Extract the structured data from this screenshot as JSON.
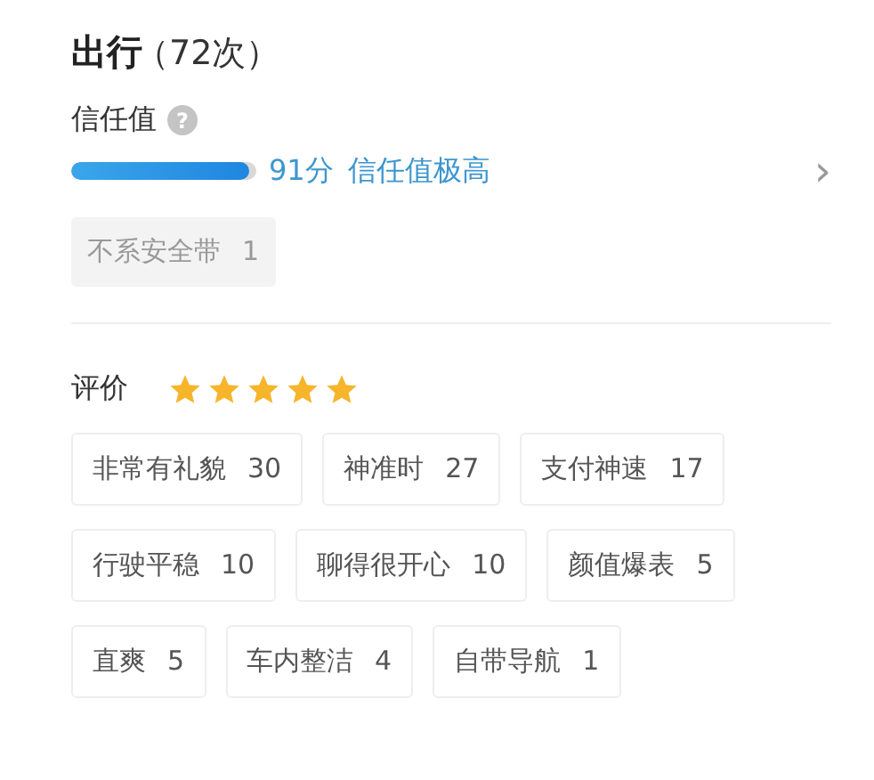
{
  "section_title": "出行",
  "trip_count": "（72次）",
  "trust": {
    "label": "信任值",
    "help_icon": "?",
    "level": 0.96,
    "score": "91分",
    "verdict": "信任值极高",
    "chevron": "›"
  },
  "warnings": [
    {
      "label": "不系安全带",
      "count": "1"
    }
  ],
  "rating": {
    "label": "评价",
    "stars": 5
  },
  "tags": [
    {
      "label": "非常有礼貌",
      "count": "30"
    },
    {
      "label": "神准时",
      "count": "27"
    },
    {
      "label": "支付神速",
      "count": "17"
    },
    {
      "label": "行驶平稳",
      "count": "10"
    },
    {
      "label": "聊得很开心",
      "count": "10"
    },
    {
      "label": "颜值爆表",
      "count": "5"
    },
    {
      "label": "直爽",
      "count": "5"
    },
    {
      "label": "车内整洁",
      "count": "4"
    },
    {
      "label": "自带导航",
      "count": "1"
    }
  ]
}
